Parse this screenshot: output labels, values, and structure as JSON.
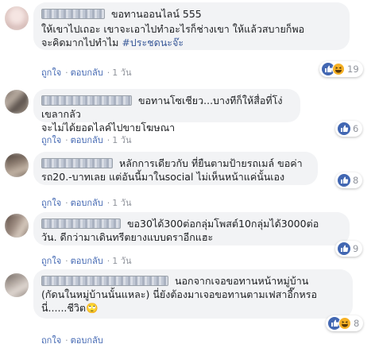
{
  "colors": {
    "bubble": "#f2f3f5",
    "link": "#385898",
    "like_blue": "#4267b2",
    "meta": "#90949c"
  },
  "actions": {
    "like": "ถูกใจ",
    "reply": "ตอบกลับ",
    "separator": "·"
  },
  "comments": [
    {
      "name": "",
      "line1": "ขอทานออนไลน์ 555",
      "line2": "ให้เขาไปเถอะ เขาจะเอาไปทำอะไรก็ช่างเขา ให้แล้วสบายก็พอ",
      "line3_text": "จะคิดมากไปทำไม ",
      "hashtag": "#ประชดนะจ๊ะ",
      "time": "1 วัน",
      "reaction_icons": [
        "like-icon",
        "haha-icon"
      ],
      "reaction_count": "19"
    },
    {
      "name": "",
      "line1": "ขอทานโซเชียว...บางทีก็ให้สื่อที่โง่เขลากลัว",
      "line2": "จะไม่ได้ยอดไลค์ไปขายโฆษณา",
      "time": "1 วัน",
      "reaction_icons": [
        "like-icon"
      ],
      "reaction_count": "6"
    },
    {
      "name": "",
      "line1": "หลักการเดียวกับ ที่ยืนตามป้ายรถเมล์ ขอค่า",
      "line2": "รถ20.-บาทเลย แต่อันนี้มาในsocial ไม่เห็นหน้าแค่นั้นเอง",
      "time": "1 วัน",
      "reaction_icons": [
        "like-icon"
      ],
      "reaction_count": "8"
    },
    {
      "name": "",
      "line1": "ขอ30ได้300ต่อกลุ่มโพสต์10กลุ่มได้3000ต่อ",
      "line2": "วัน. ดีกว่ามาเดินทรีตยางแบบดราอีกแฮะ",
      "time": "1 วัน",
      "reaction_icons": [
        "like-icon"
      ],
      "reaction_count": "9"
    },
    {
      "name": "",
      "line1": "นอกจากเจอขอทานหน้าหมู่บ้าน",
      "line2": "(กัดนในหมู่บ้านนั้นแหละ) นี่ยังต้องมาเจอขอทานตามเฟสาอี๊กหรอ",
      "line3_text": "นี่......ชีวิต",
      "line3_emoji": "🙄",
      "time": "",
      "reaction_icons": [
        "like-icon",
        "haha-icon"
      ],
      "reaction_count": "8"
    }
  ]
}
